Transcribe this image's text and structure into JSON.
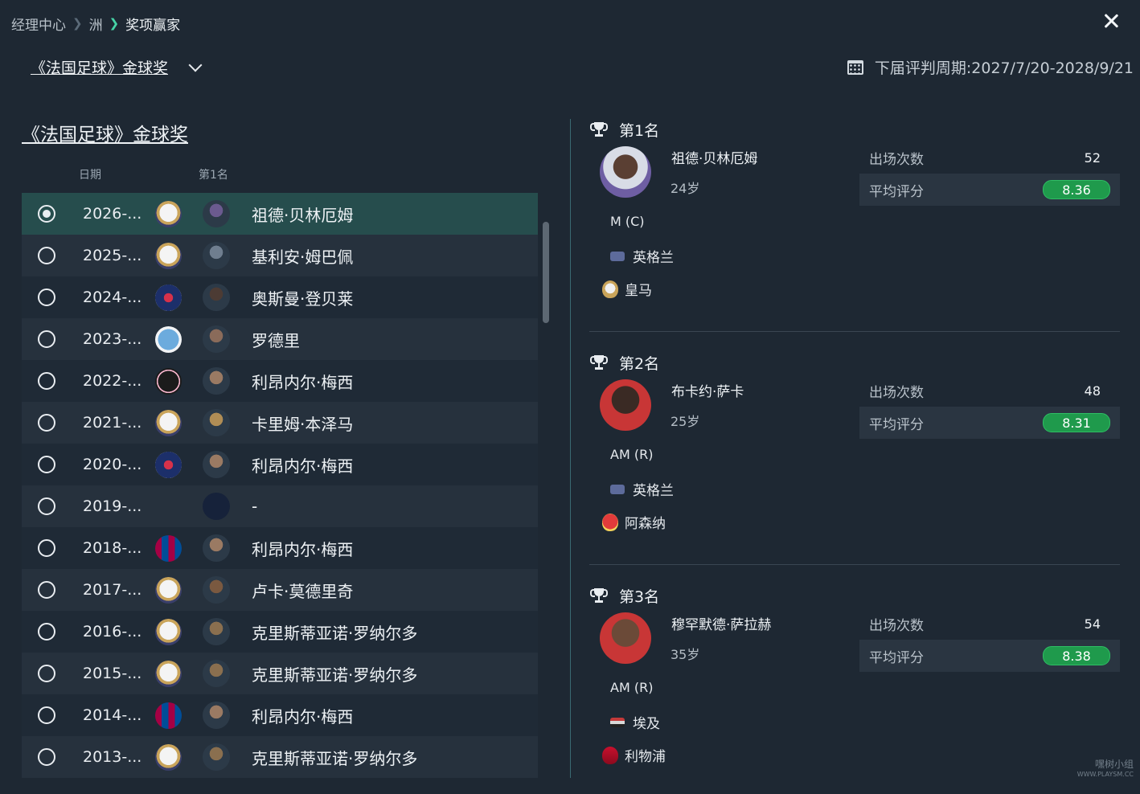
{
  "breadcrumb": {
    "root": "经理中心",
    "mid": "洲",
    "current": "奖项赢家"
  },
  "selector": {
    "label": "《法国足球》金球奖"
  },
  "cycle": {
    "text": "下届评判周期:2027/7/20-2028/9/21"
  },
  "left": {
    "title": "《法国足球》金球奖",
    "col_date": "日期",
    "col_first": "第1名"
  },
  "rows": [
    {
      "year": "2026-...",
      "club": "real-madrid",
      "name": "祖德·贝林厄姆",
      "selected": true
    },
    {
      "year": "2025-...",
      "club": "real-madrid",
      "name": "基利安·姆巴佩"
    },
    {
      "year": "2024-...",
      "club": "psg",
      "name": "奥斯曼·登贝莱"
    },
    {
      "year": "2023-...",
      "club": "man-city",
      "name": "罗德里"
    },
    {
      "year": "2022-...",
      "club": "inter-miami",
      "name": "利昂内尔·梅西"
    },
    {
      "year": "2021-...",
      "club": "real-madrid",
      "name": "卡里姆·本泽马"
    },
    {
      "year": "2020-...",
      "club": "psg",
      "name": "利昂内尔·梅西"
    },
    {
      "year": "2019-...",
      "club": "",
      "name": "-"
    },
    {
      "year": "2018-...",
      "club": "barcelona",
      "name": "利昂内尔·梅西"
    },
    {
      "year": "2017-...",
      "club": "real-madrid",
      "name": "卢卡·莫德里奇"
    },
    {
      "year": "2016-...",
      "club": "real-madrid",
      "name": "克里斯蒂亚诺·罗纳尔多"
    },
    {
      "year": "2015-...",
      "club": "real-madrid",
      "name": "克里斯蒂亚诺·罗纳尔多"
    },
    {
      "year": "2014-...",
      "club": "barcelona",
      "name": "利昂内尔·梅西"
    },
    {
      "year": "2013-...",
      "club": "real-madrid",
      "name": "克里斯蒂亚诺·罗纳尔多"
    }
  ],
  "ranks": [
    {
      "title": "第1名",
      "name": "祖德·贝林厄姆",
      "age": "24岁",
      "position": "M (C)",
      "nation": "英格兰",
      "club": "皇马",
      "apps_label": "出场次数",
      "apps": "52",
      "rating_label": "平均评分",
      "rating": "8.36"
    },
    {
      "title": "第2名",
      "name": "布卡约·萨卡",
      "age": "25岁",
      "position": "AM (R)",
      "nation": "英格兰",
      "club": "阿森纳",
      "apps_label": "出场次数",
      "apps": "48",
      "rating_label": "平均评分",
      "rating": "8.31"
    },
    {
      "title": "第3名",
      "name": "穆罕默德·萨拉赫",
      "age": "35岁",
      "position": "AM (R)",
      "nation": "埃及",
      "club": "利物浦",
      "apps_label": "出场次数",
      "apps": "54",
      "rating_label": "平均评分",
      "rating": "8.38"
    }
  ],
  "watermark": {
    "line1": "嘿树小组",
    "line2": "WWW.PLAYSM.CC"
  }
}
